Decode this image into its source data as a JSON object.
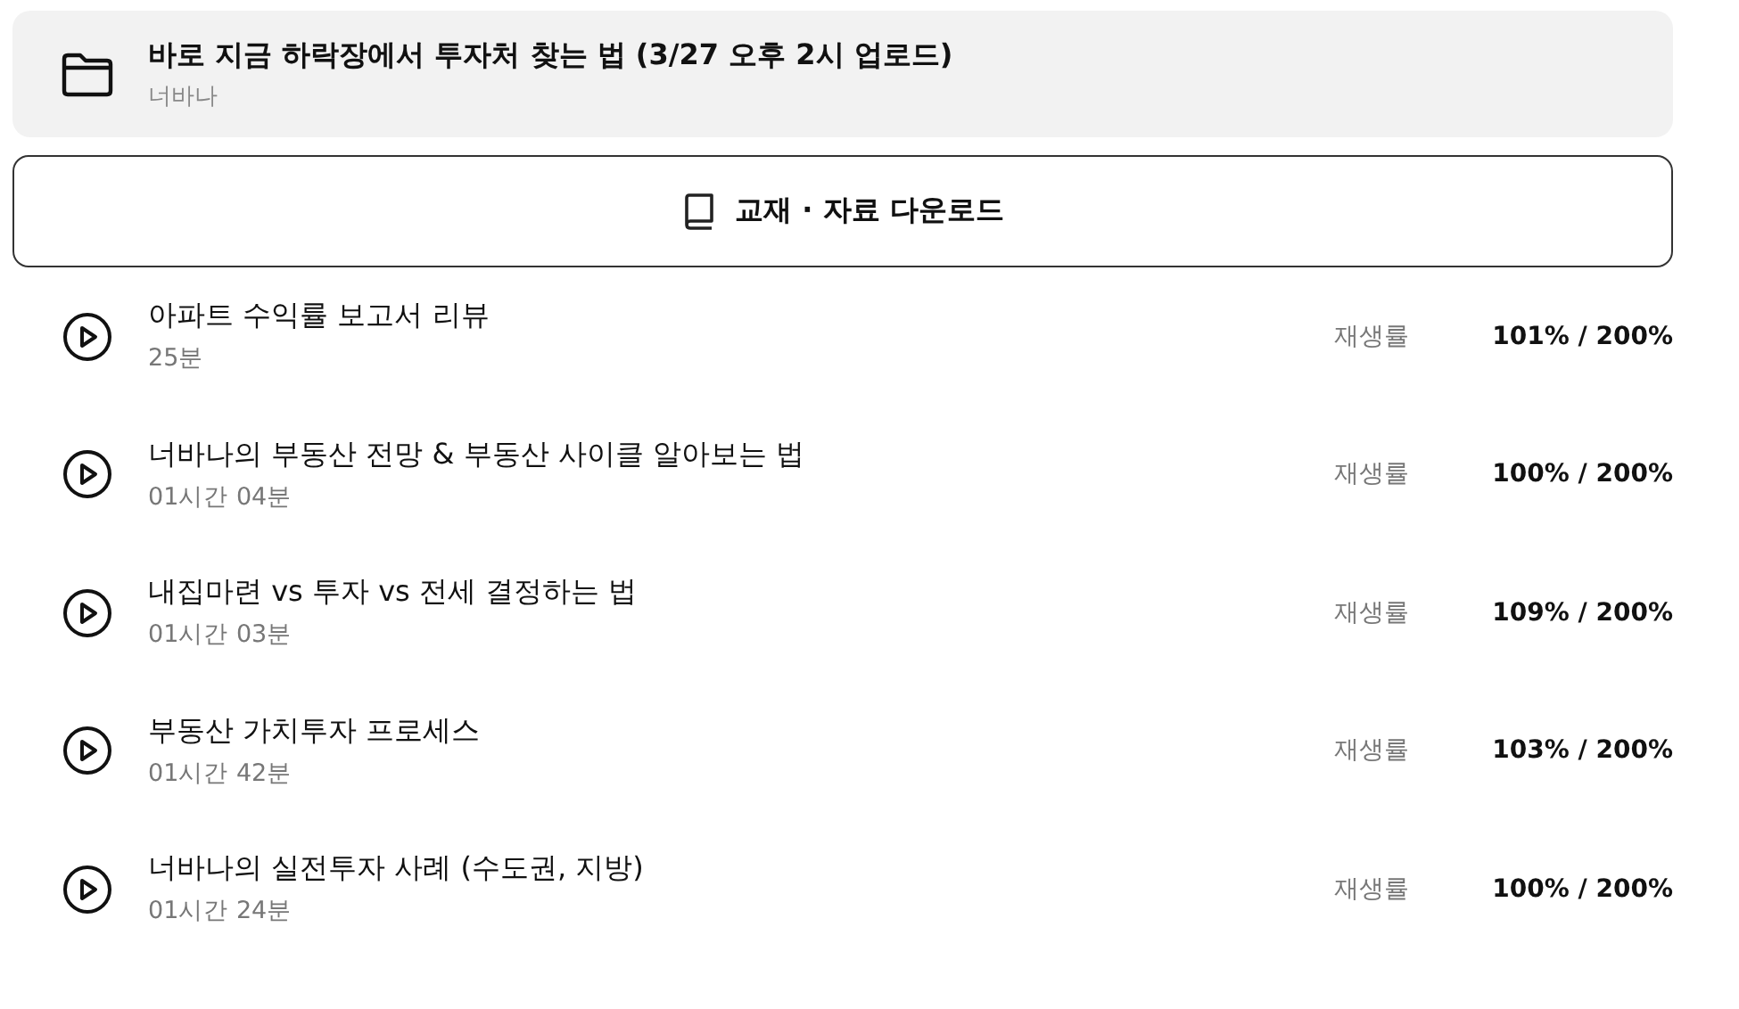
{
  "folder": {
    "title": "바로 지금 하락장에서 투자처 찾는 법 (3/27 오후 2시 업로드)",
    "author": "너바나"
  },
  "download_button": {
    "label": "교재 · 자료 다운로드"
  },
  "lectures": [
    {
      "title": "아파트 수익률 보고서 리뷰",
      "duration": "25분",
      "progress_label": "재생률",
      "progress": "101% / 200%"
    },
    {
      "title": "너바나의 부동산 전망 & 부동산 사이클 알아보는 법",
      "duration": "01시간 04분",
      "progress_label": "재생률",
      "progress": "100% / 200%"
    },
    {
      "title": "내집마련 vs 투자 vs 전세 결정하는 법",
      "duration": "01시간 03분",
      "progress_label": "재생률",
      "progress": "109% / 200%"
    },
    {
      "title": "부동산 가치투자 프로세스",
      "duration": "01시간 42분",
      "progress_label": "재생률",
      "progress": "103% / 200%"
    },
    {
      "title": "너바나의 실전투자 사례 (수도권, 지방)",
      "duration": "01시간 24분",
      "progress_label": "재생률",
      "progress": "100% / 200%"
    }
  ]
}
